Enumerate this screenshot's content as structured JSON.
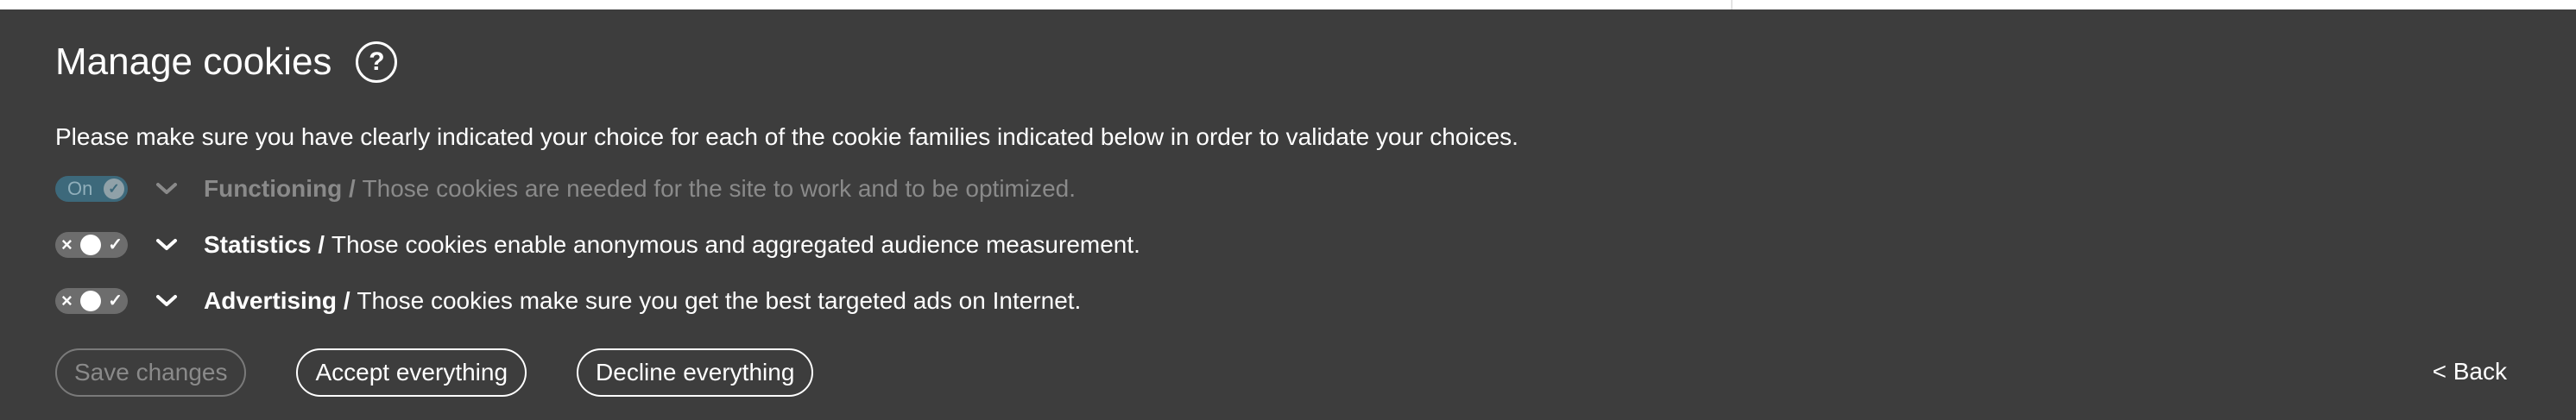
{
  "dialog": {
    "title": "Manage cookies",
    "help_label": "?",
    "intro": "Please make sure you have clearly indicated your choice for each of the cookie families indicated below in order to validate your choices."
  },
  "families": [
    {
      "toggle_label": "On",
      "toggle_state": "on",
      "name": "Functioning",
      "separator": "/",
      "description": "Those cookies are needed for the site to work and to be optimized."
    },
    {
      "toggle_label": "",
      "toggle_state": "off",
      "name": "Statistics",
      "separator": "/",
      "description": "Those cookies enable anonymous and aggregated audience measurement."
    },
    {
      "toggle_label": "",
      "toggle_state": "off",
      "name": "Advertising",
      "separator": "/",
      "description": "Those cookies make sure you get the best targeted ads on Internet."
    }
  ],
  "buttons": {
    "save": "Save changes",
    "accept": "Accept everything",
    "decline": "Decline everything",
    "back": "< Back"
  },
  "colors": {
    "panel_bg": "#3d3d3d",
    "toggle_on": "#3d7186",
    "toggle_off": "#6d6d6d",
    "disabled_text": "#8a8a8a"
  }
}
